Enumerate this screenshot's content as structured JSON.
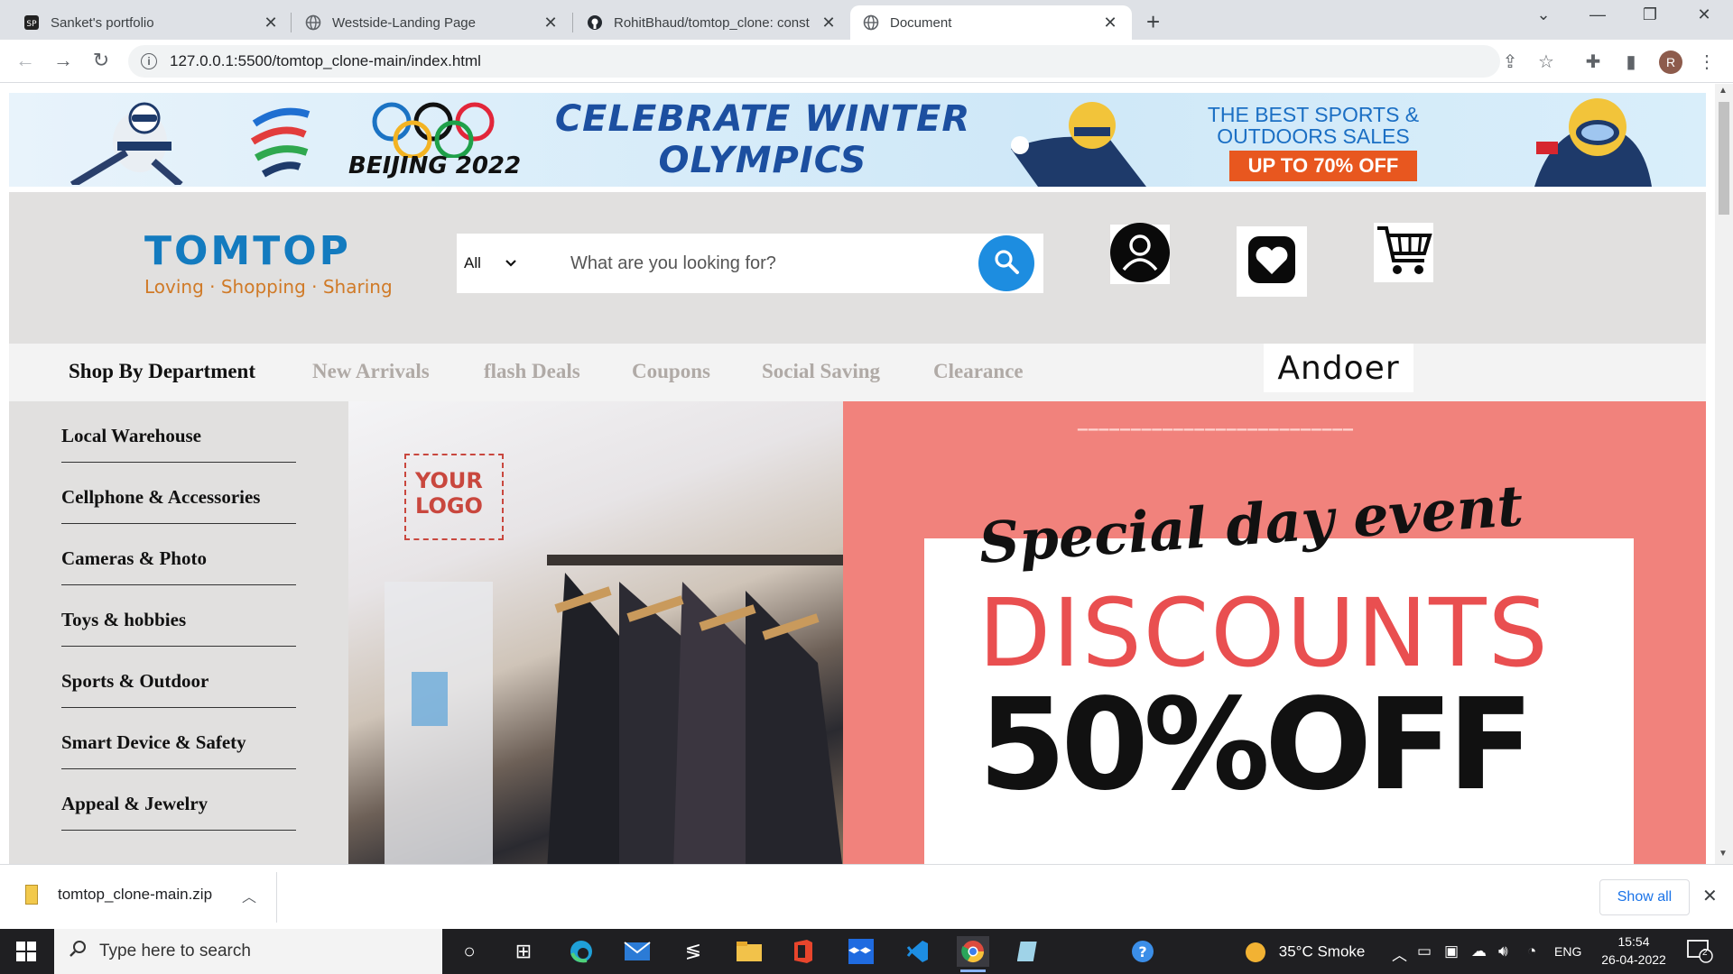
{
  "browser": {
    "tabs": [
      {
        "title": "Sanket's portfolio",
        "icon": "portfolio-icon"
      },
      {
        "title": "Westside-Landing Page",
        "icon": "globe-icon"
      },
      {
        "title": "RohitBhaud/tomtop_clone: const",
        "icon": "github-icon"
      },
      {
        "title": "Document",
        "icon": "globe-icon",
        "active": true
      }
    ],
    "url": "127.0.0.1:5500/tomtop_clone-main/index.html",
    "profile_initial": "R"
  },
  "banner": {
    "location": "BEIJING 2022",
    "headline": "CELEBRATE WINTER OLYMPICS",
    "sales_line": "THE BEST SPORTS & OUTDOORS SALES",
    "offer": "UP TO 70% OFF"
  },
  "header": {
    "brand": "TOMTOP",
    "tagline": "Loving · Shopping · Sharing",
    "category": "All",
    "search_placeholder": "What are you looking for?"
  },
  "nav": {
    "items": [
      "Shop By Department",
      "New Arrivals",
      "flash Deals",
      "Coupons",
      "Social Saving",
      "Clearance"
    ],
    "partner": "Andoer"
  },
  "sidebar": {
    "items": [
      "Local Warehouse",
      "Cellphone & Accessories",
      "Cameras & Photo",
      "Toys & hobbies",
      "Sports & Outdoor",
      "Smart Device & Safety",
      "Appeal & Jewelry"
    ]
  },
  "hero": {
    "logo_placeholder": "YOUR LOGO",
    "event": "Special day event",
    "discounts": "DISCOUNTS",
    "offer": "50%OFF"
  },
  "downloads": {
    "file": "tomtop_clone-main.zip",
    "show_all": "Show all"
  },
  "taskbar": {
    "search_placeholder": "Type here to search",
    "weather": "35°C  Smoke",
    "language": "ENG",
    "time": "15:54",
    "date": "26-04-2022",
    "notifications": "2"
  },
  "colors": {
    "brand_blue": "#137bbf",
    "search_button": "#1d8de0",
    "hero_pink": "#f1827c",
    "discount_red": "#e94f50"
  }
}
